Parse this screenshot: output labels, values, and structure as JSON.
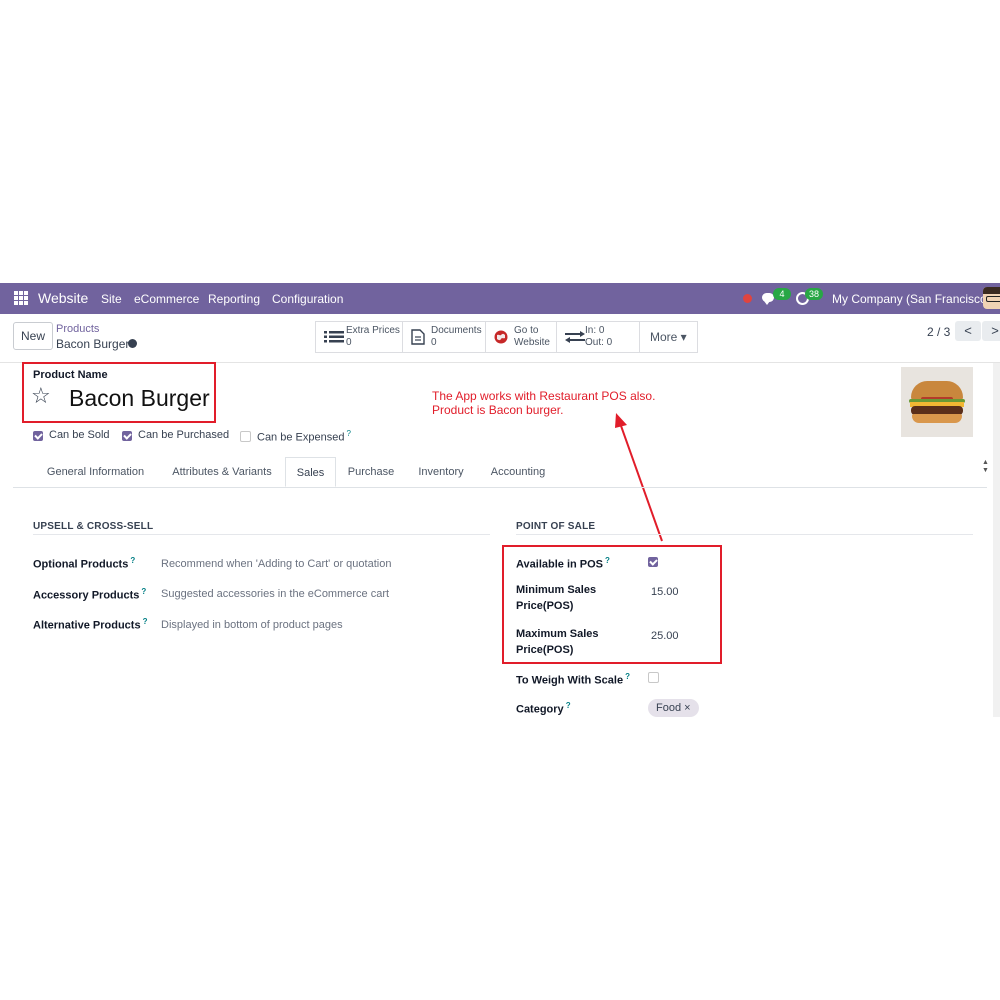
{
  "navbar": {
    "app_name": "Website",
    "menu": [
      "Site",
      "eCommerce",
      "Reporting",
      "Configuration"
    ],
    "messages_count": "4",
    "activities_count": "38",
    "company": "My Company (San Francisco)"
  },
  "control": {
    "new_label": "New",
    "breadcrumb_parent": "Products",
    "breadcrumb_current": "Bacon Burger",
    "stats": {
      "extra_prices_label": "Extra Prices",
      "extra_prices_value": "0",
      "documents_label": "Documents",
      "documents_value": "0",
      "website_l1": "Go to",
      "website_l2": "Website",
      "in_label": "In: 0",
      "out_label": "Out: 0",
      "more_label": "More ▾"
    },
    "pager": "2 / 3",
    "prev": "<",
    "next": ">"
  },
  "form": {
    "name_label": "Product Name",
    "name_value": "Bacon Burger",
    "can_be_sold": "Can be Sold",
    "can_be_purchased": "Can be Purchased",
    "can_be_expensed": "Can be Expensed",
    "tooltip_mark": "?",
    "tabs": [
      "General Information",
      "Attributes & Variants",
      "Sales",
      "Purchase",
      "Inventory",
      "Accounting"
    ],
    "active_tab": "Sales",
    "upsell": {
      "title": "UPSELL & CROSS-SELL",
      "optional_label": "Optional Products",
      "optional_placeholder": "Recommend when 'Adding to Cart' or quotation",
      "accessory_label": "Accessory Products",
      "accessory_placeholder": "Suggested accessories in the eCommerce cart",
      "alternative_label": "Alternative Products",
      "alternative_placeholder": "Displayed in bottom of product pages"
    },
    "pos": {
      "title": "POINT OF SALE",
      "available_label": "Available in POS",
      "available_checked": true,
      "min_label_1": "Minimum Sales",
      "min_label_2": "Price(POS)",
      "min_value": "15.00",
      "max_label_1": "Maximum Sales",
      "max_label_2": "Price(POS)",
      "max_value": "25.00",
      "scale_label": "To Weigh With Scale",
      "scale_checked": false,
      "category_label": "Category",
      "category_tag": "Food",
      "tag_remove": "×"
    }
  },
  "annotation": {
    "line1": "The App works with Restaurant POS also.",
    "line2": "Product is Bacon burger."
  },
  "colors": {
    "brand": "#71639e",
    "annotation": "#e11d2a",
    "badge": "#28a745"
  }
}
